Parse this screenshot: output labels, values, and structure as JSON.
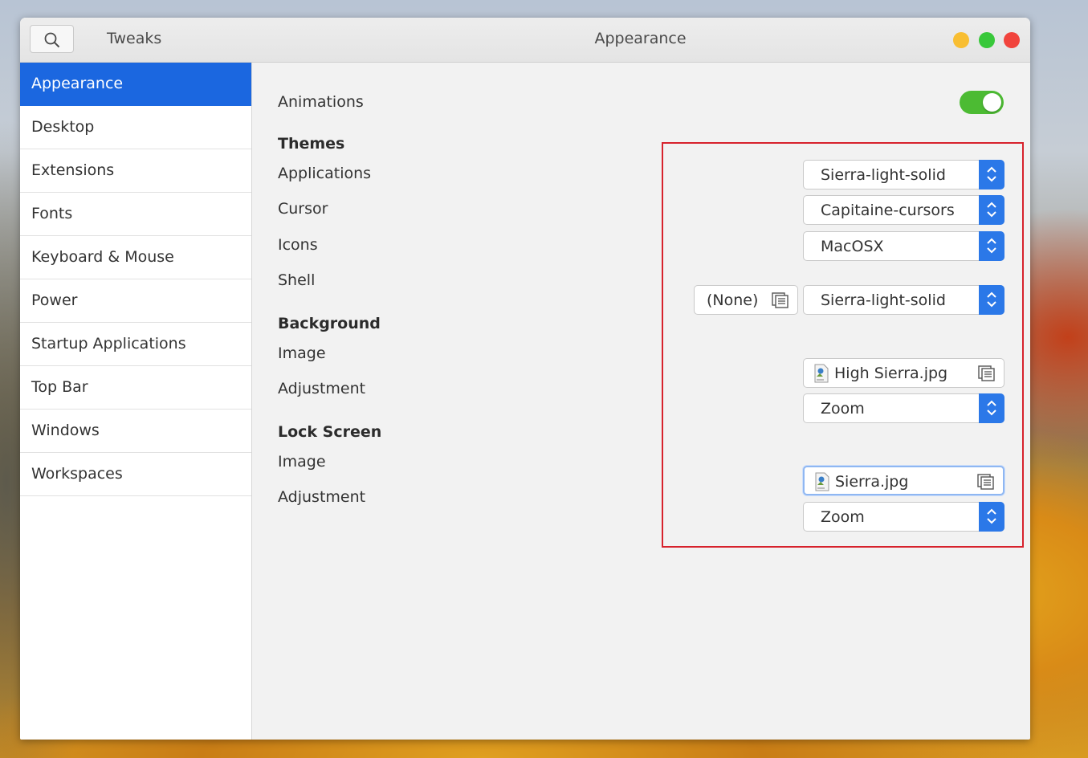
{
  "titlebar": {
    "app_name": "Tweaks",
    "title": "Appearance"
  },
  "sidebar": {
    "items": [
      {
        "label": "Appearance",
        "active": true
      },
      {
        "label": "Desktop"
      },
      {
        "label": "Extensions"
      },
      {
        "label": "Fonts"
      },
      {
        "label": "Keyboard & Mouse"
      },
      {
        "label": "Power"
      },
      {
        "label": "Startup Applications"
      },
      {
        "label": "Top Bar"
      },
      {
        "label": "Windows"
      },
      {
        "label": "Workspaces"
      }
    ]
  },
  "main": {
    "animations": {
      "label": "Animations",
      "enabled": true
    },
    "themes": {
      "header": "Themes",
      "applications": {
        "label": "Applications",
        "value": "Sierra-light-solid"
      },
      "cursor": {
        "label": "Cursor",
        "value": "Capitaine-cursors"
      },
      "icons": {
        "label": "Icons",
        "value": "MacOSX"
      },
      "shell": {
        "label": "Shell",
        "file": "(None)",
        "value": "Sierra-light-solid"
      }
    },
    "background": {
      "header": "Background",
      "image": {
        "label": "Image",
        "file": "High Sierra.jpg"
      },
      "adjustment": {
        "label": "Adjustment",
        "value": "Zoom"
      }
    },
    "lock_screen": {
      "header": "Lock Screen",
      "image": {
        "label": "Image",
        "file": "Sierra.jpg"
      },
      "adjustment": {
        "label": "Adjustment",
        "value": "Zoom"
      }
    }
  },
  "colors": {
    "accent": "#1b67e0",
    "combo_arrow": "#2b78e8",
    "toggle_on": "#4cbb33",
    "highlight_box": "#d7222c"
  }
}
